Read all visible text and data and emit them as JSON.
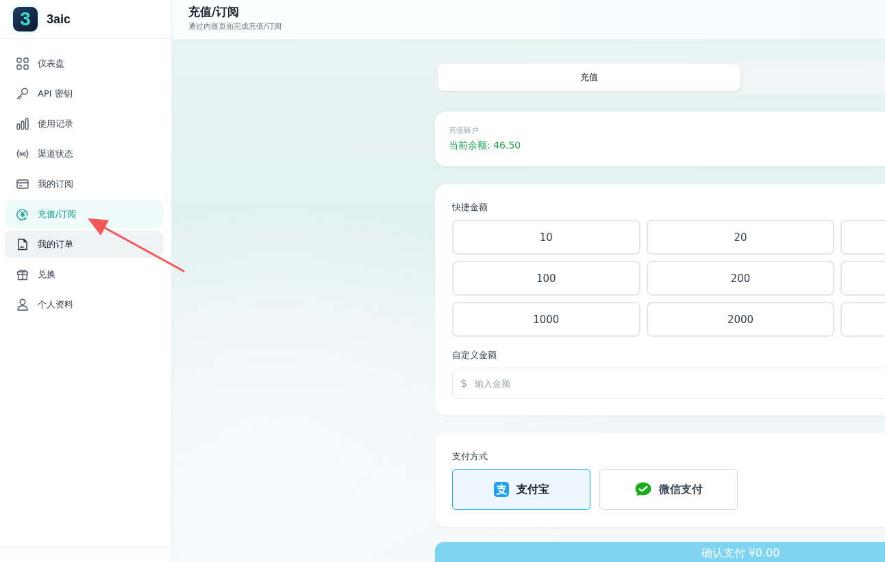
{
  "sidebar": {
    "brand": {
      "mark": "3",
      "name": "3aic"
    },
    "items": [
      {
        "label": "仪表盘",
        "selected": false,
        "hovered": false
      },
      {
        "label": "API 密钥",
        "selected": false,
        "hovered": false
      },
      {
        "label": "使用记录",
        "selected": false,
        "hovered": false
      },
      {
        "label": "渠道状态",
        "selected": false,
        "hovered": false
      },
      {
        "label": "我的订阅",
        "selected": false,
        "hovered": false
      },
      {
        "label": "充值/订阅",
        "selected": true,
        "hovered": false
      },
      {
        "label": "我的订单",
        "selected": false,
        "hovered": true
      },
      {
        "label": "兑换",
        "selected": false,
        "hovered": false
      },
      {
        "label": "个人资料",
        "selected": false,
        "hovered": false
      }
    ]
  },
  "header": {
    "title": "充值/订阅",
    "subtitle": "通过内嵌页面完成充值/订阅"
  },
  "tabs": [
    {
      "label": "充值",
      "selected": true
    }
  ],
  "account": {
    "label": "充值账户",
    "balance": "当前余额: 46.50"
  },
  "amounts": {
    "label": "快捷金额",
    "rows": [
      [
        "10",
        "20"
      ],
      [
        "100",
        "200"
      ],
      [
        "1000",
        "2000"
      ]
    ]
  },
  "custom_amount": {
    "label": "自定义金额",
    "prefix": "$",
    "placeholder": "输入金额"
  },
  "payment": {
    "label": "支付方式",
    "methods": [
      {
        "label": "支付宝",
        "selected": true
      },
      {
        "label": "微信支付",
        "selected": false
      }
    ]
  },
  "confirm": {
    "label": "确认支付 ¥0.00",
    "disabled": true
  }
}
